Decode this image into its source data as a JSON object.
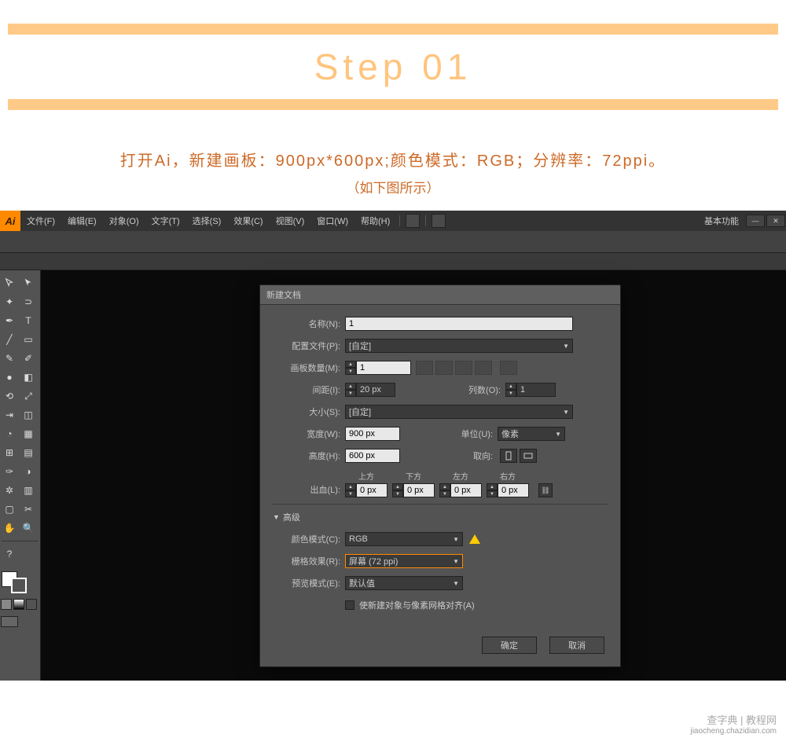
{
  "banner": {
    "title": "Step 01"
  },
  "instruction": {
    "main": "打开Ai，新建画板：900px*600px;颜色模式：RGB；分辨率：72ppi。",
    "sub": "（如下图所示）"
  },
  "menu": {
    "items": [
      "文件(F)",
      "编辑(E)",
      "对象(O)",
      "文字(T)",
      "选择(S)",
      "效果(C)",
      "视图(V)",
      "窗口(W)",
      "帮助(H)"
    ],
    "workspace": "基本功能"
  },
  "dialog": {
    "title": "新建文档",
    "labels": {
      "name": "名称(N):",
      "profile": "配置文件(P):",
      "artboards": "画板数量(M):",
      "spacing": "间距(I):",
      "columns": "列数(O):",
      "size": "大小(S):",
      "width": "宽度(W):",
      "height": "高度(H):",
      "units": "单位(U):",
      "orient": "取向:",
      "bleed": "出血(L):",
      "top": "上方",
      "bottom": "下方",
      "left": "左方",
      "right": "右方",
      "advanced": "高级",
      "colormode": "颜色模式(C):",
      "raster": "栅格效果(R):",
      "preview": "预览模式(E):",
      "align_pixel": "使新建对象与像素网格对齐(A)"
    },
    "values": {
      "name": "1",
      "profile": "[自定]",
      "artboards": "1",
      "spacing": "20 px",
      "columns": "1",
      "size": "[自定]",
      "width": "900 px",
      "height": "600 px",
      "units": "像素",
      "bleed": "0 px",
      "colormode": "RGB",
      "raster": "屏幕 (72 ppi)",
      "preview": "默认值"
    },
    "buttons": {
      "ok": "确定",
      "cancel": "取消"
    }
  },
  "watermark": {
    "main": "查字典 | 教程网",
    "sub": "jiaocheng.chazidian.com"
  }
}
